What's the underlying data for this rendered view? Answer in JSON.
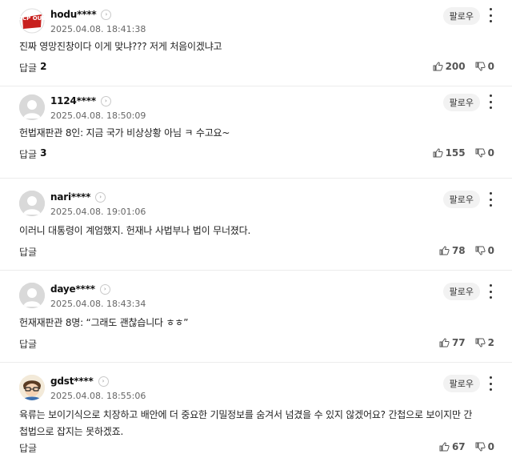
{
  "follow_label": "팔로우",
  "reply_label": "답글",
  "comments": [
    {
      "nick": "hodu****",
      "date": "2025.04.08. 18:41:38",
      "text": "진짜 영망진창이다 이게 맞냐??? 저게 처음이겠냐고",
      "reply_count": "2",
      "likes": "200",
      "dislikes": "0",
      "avatar_text": "CCP OUT"
    },
    {
      "nick": "1124****",
      "date": "2025.04.08. 18:50:09",
      "text": "헌법재판관 8인: 지금 국가 비상상황 아님 ㅋ 수고요~",
      "reply_count": "3",
      "likes": "155",
      "dislikes": "0"
    },
    {
      "nick": "nari****",
      "date": "2025.04.08. 19:01:06",
      "text": "이러니 대통령이 계엄했지. 헌재나 사법부나 법이 무너졌다.",
      "reply_count": "",
      "likes": "78",
      "dislikes": "0"
    },
    {
      "nick": "daye****",
      "date": "2025.04.08. 18:43:34",
      "text": "헌재재판관 8명: “그래도 괜찮습니다 ㅎㅎ”",
      "reply_count": "",
      "likes": "77",
      "dislikes": "2"
    },
    {
      "nick": "gdst****",
      "date": "2025.04.08. 18:55:06",
      "text": "육류는 보이기식으로 치장하고 배안에 더 중요한 기밀정보를 숨겨서 넘겼을 수 있지 않겠어요? 간첩으로 보이지만 간첩법으로 잡지는 못하겠죠.",
      "reply_count": "",
      "likes": "67",
      "dislikes": "0"
    }
  ]
}
